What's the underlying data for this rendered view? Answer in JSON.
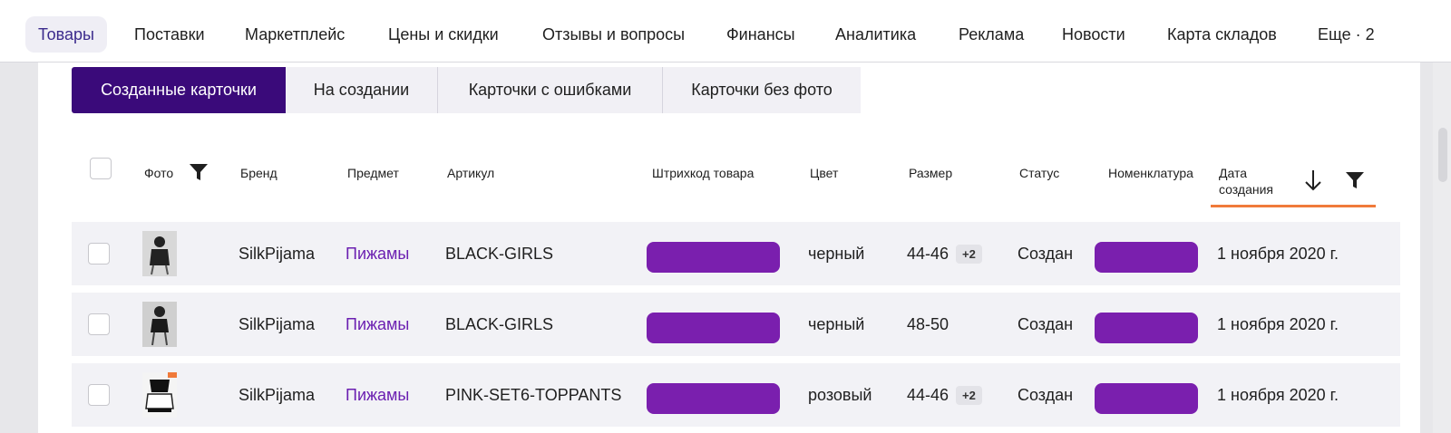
{
  "nav": {
    "items": [
      {
        "label": "Товары",
        "active": true
      },
      {
        "label": "Поставки"
      },
      {
        "label": "Маркетплейс"
      },
      {
        "label": "Цены и скидки"
      },
      {
        "label": "Отзывы и вопросы"
      },
      {
        "label": "Финансы"
      },
      {
        "label": "Аналитика"
      },
      {
        "label": "Реклама"
      },
      {
        "label": "Новости"
      },
      {
        "label": "Карта складов"
      },
      {
        "label": "Еще · 2"
      }
    ]
  },
  "tabs": [
    {
      "label": "Созданные карточки",
      "active": true
    },
    {
      "label": "На создании"
    },
    {
      "label": "Карточки с ошибками"
    },
    {
      "label": "Карточки без фото"
    }
  ],
  "table": {
    "headers": {
      "photo": "Фото",
      "brand": "Бренд",
      "subject": "Предмет",
      "article": "Артикул",
      "barcode": "Штрихкод товара",
      "color": "Цвет",
      "size": "Размер",
      "status": "Статус",
      "nomenclature": "Номенклатура",
      "created_line1": "Дата",
      "created_line2": "создания"
    },
    "rows": [
      {
        "brand": "SilkPijama",
        "subject": "Пижамы",
        "article": "BLACK-GIRLS",
        "color": "черный",
        "size": "44-46",
        "size_extra": "+2",
        "status": "Создан",
        "created": "1 ноября 2020 г."
      },
      {
        "brand": "SilkPijama",
        "subject": "Пижамы",
        "article": "BLACK-GIRLS",
        "color": "черный",
        "size": "48-50",
        "size_extra": "",
        "status": "Создан",
        "created": "1 ноября 2020 г."
      },
      {
        "brand": "SilkPijama",
        "subject": "Пижамы",
        "article": "PINK-SET6-TOPPANTS",
        "color": "розовый",
        "size": "44-46",
        "size_extra": "+2",
        "status": "Создан",
        "created": "1 ноября 2020 г."
      }
    ]
  },
  "colors": {
    "accent": "#3a0a7a",
    "link": "#6b1fb1",
    "redaction": "#7a1fae",
    "sort_indicator": "#f07a3a"
  }
}
